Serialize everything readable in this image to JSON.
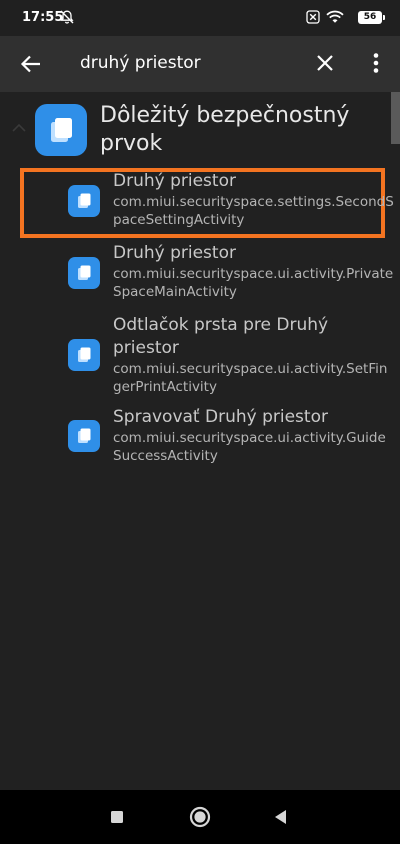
{
  "status_bar": {
    "time": "17:55",
    "battery": "56",
    "icons": [
      "mute-bell-icon",
      "close-box-icon",
      "wifi-icon",
      "battery-icon"
    ]
  },
  "search": {
    "query": "druhý priestor"
  },
  "app": {
    "name": "Dôležitý bezpečnostný prvok",
    "icon": "security-app-icon",
    "icon_color": "#2f8fe8"
  },
  "activities": [
    {
      "title": "Druhý priestor",
      "activity": "com.miui.securityspace.settings.SecondSpaceSettingActivity"
    },
    {
      "title": "Druhý priestor",
      "activity": "com.miui.securityspace.ui.activity.PrivateSpaceMainActivity"
    },
    {
      "title": "Odtlačok prsta pre Druhý priestor",
      "activity": "com.miui.securityspace.ui.activity.SetFingerPrintActivity"
    },
    {
      "title": "Spravovať Druhý priestor",
      "activity": "com.miui.securityspace.ui.activity.GuideSuccessActivity"
    }
  ],
  "colors": {
    "highlight": "#f47421",
    "background": "#212121",
    "toolbar": "#303030"
  }
}
